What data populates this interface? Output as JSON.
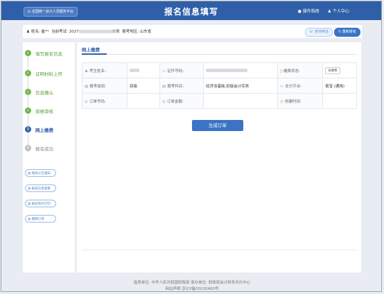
{
  "header": {
    "home_label": "全国统一会计人员服务平台",
    "title": "报名信息填写",
    "guide": "操作指南",
    "personal": "个人中心"
  },
  "info": {
    "name_label": "姓名:",
    "name_value": "崔**",
    "exam_label": "当前考试:",
    "exam_value": "2027",
    "exam_tail": "分类",
    "region_label": "报考地区:",
    "region_value": "山东省",
    "help_button": "咨询电话",
    "back_button": "重新报名"
  },
  "sidebar": {
    "steps": [
      {
        "label": "填写报名信息",
        "state": "done",
        "mark": "✓"
      },
      {
        "label": "证明材料上传",
        "state": "done",
        "mark": "✓"
      },
      {
        "label": "信息确认",
        "state": "done",
        "mark": "✓"
      },
      {
        "label": "资格审核",
        "state": "done",
        "mark": "✓"
      },
      {
        "label": "网上缴费",
        "state": "current",
        "mark": "5"
      },
      {
        "label": "报名成功",
        "state": "todo",
        "mark": "6"
      }
    ],
    "links": [
      "相关公告通知",
      "报名信息查看",
      "报名照片打印",
      "撤销订单"
    ]
  },
  "main": {
    "tab": "网上缴费",
    "rows": [
      [
        {
          "icon": "user-icon",
          "label": "考生姓名:",
          "value": ""
        },
        {
          "icon": "id-icon",
          "label": "证件号码:",
          "value": ""
        },
        {
          "icon": "phone-icon",
          "label": "缴费状态:",
          "value": "",
          "button": "未缴费"
        }
      ],
      [
        {
          "icon": "doc-icon",
          "label": "报考级别:",
          "value": "初级"
        },
        {
          "icon": "book-icon",
          "label": "报考科目:",
          "value": "经济法基础,初级会计实务"
        },
        {
          "icon": "card-icon",
          "label": "支付平台:",
          "value": "易宝 (通用)"
        }
      ],
      [
        {
          "icon": "order-icon",
          "label": "订单号码:",
          "value": ""
        },
        {
          "icon": "money-icon",
          "label": "订单金额:",
          "value": ""
        },
        {
          "icon": "clock-icon",
          "label": "创建时间:",
          "value": ""
        }
      ]
    ],
    "generate_button": "生成订单"
  },
  "footer": {
    "line1": "指导单位: 中华人民共和国财政部    承办单位: 财政部会计财务评价中心",
    "line2": "网站声明    京ICP备05020460号"
  }
}
